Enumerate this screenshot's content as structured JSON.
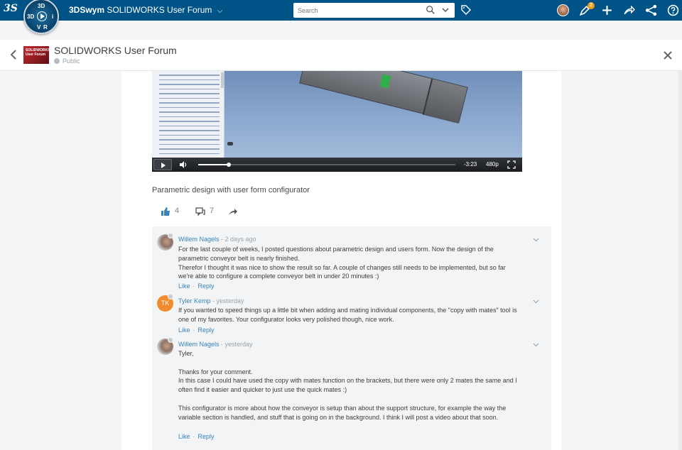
{
  "topbar": {
    "logo": "3S",
    "compass": {
      "top": "3D",
      "left": "3D",
      "right": "i",
      "bottom_left": "V",
      "bottom_right": "R",
      "play_icon": "play-icon"
    },
    "app_name": "3DSwym",
    "community": "SOLIDWORKS User Forum",
    "search_placeholder": "Search",
    "notification_count": "2"
  },
  "header": {
    "thumb_text": "SOLIDWORKS User Forum",
    "title": "SOLIDWORKS User Forum",
    "visibility": "Public"
  },
  "post": {
    "video": {
      "time": "-3:23",
      "quality": "480p",
      "progress": 0.12
    },
    "caption": "Parametric design with user form configurator",
    "likes": "4",
    "comments_count": "7"
  },
  "comments": [
    {
      "author": "Willem Nagels",
      "time": " - 2 days ago",
      "lines": [
        "For the last couple of weeks, I posted questions about parametric design and users form. Now the design of the",
        "parametric conveyor belt is nearly finished.",
        "Therefor I thought it was nice to show the result so far. A couple of changes still needs to be implemented, but so far",
        "we're able to configure a complete conveyor belt in under 20 minutes :)"
      ],
      "like": "Like",
      "reply": "Reply"
    },
    {
      "author": "Tyler Kemp",
      "initials": "TK",
      "time": " - yesterday",
      "lines": [
        "If you wanted to speed things up a little bit when adding and mating individual components, the \"copy with mates\" tool is",
        "one of my favorites. Your configurator looks very polished though, nice work."
      ],
      "like": "Like",
      "reply": "Reply"
    },
    {
      "author": "Willem Nagels",
      "time": " - yesterday",
      "lines": [
        "Tyler,",
        "",
        "Thanks for your comment.",
        "In this case I could have used the copy with mates function on the brackets, but there were only 2 mates the same and I",
        "often find it easier and quicker to just use the quick mates :)",
        "",
        "This configurator is more about how the conveyor is setup than about the support structure, for example the way the",
        "variable section is handled, and stuff that is going on in the background. I think I will post a video about that soon."
      ],
      "like": "Like",
      "reply": "Reply"
    }
  ],
  "colors": {
    "topbar": "#005386",
    "link": "#3883b8",
    "accent": "#f39c12"
  }
}
